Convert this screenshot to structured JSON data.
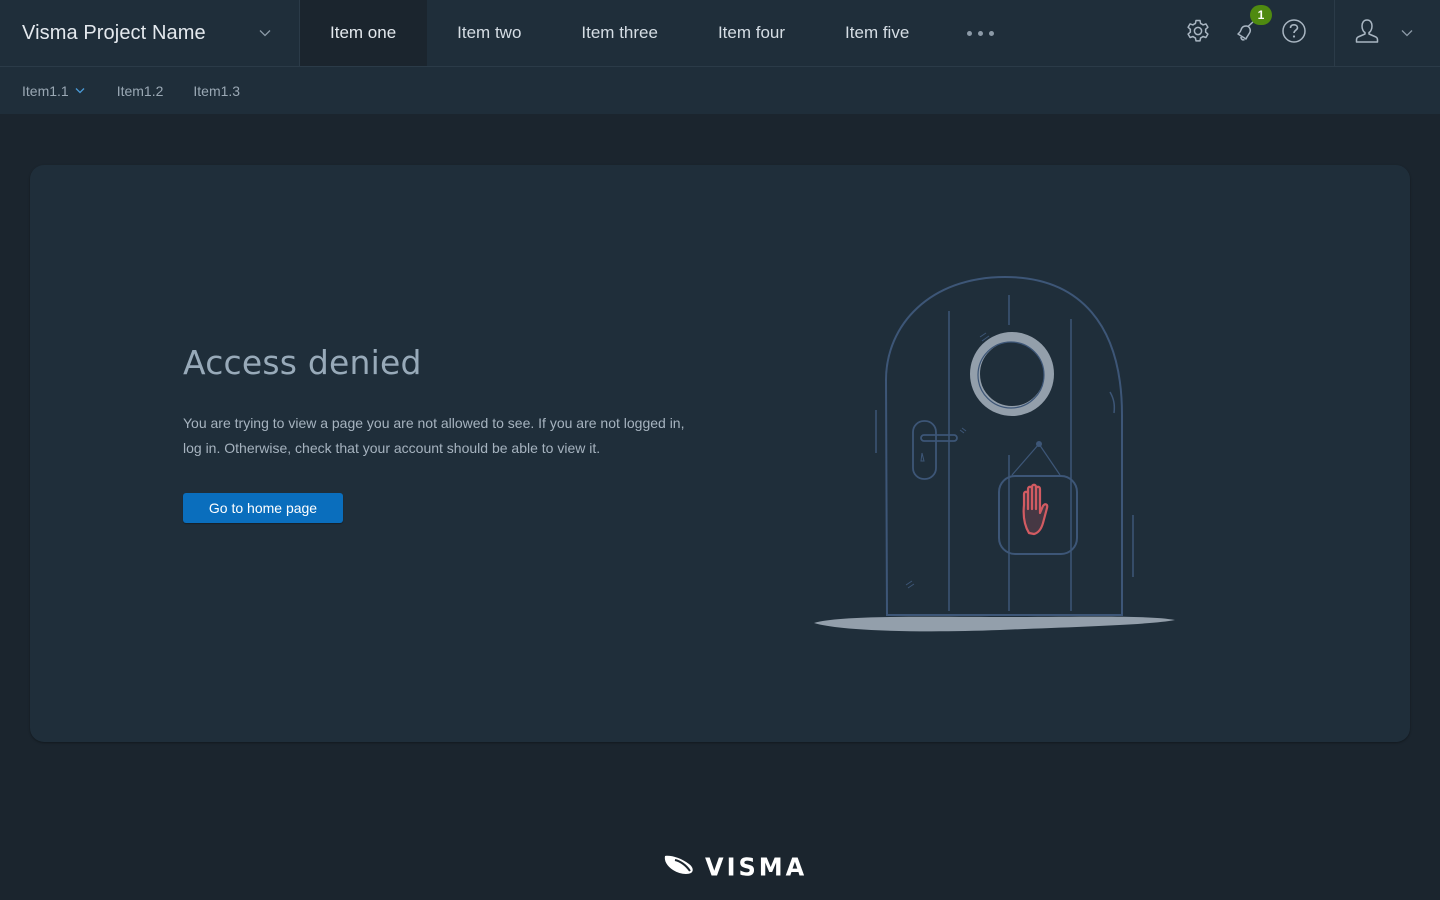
{
  "header": {
    "project_name": "Visma Project Name",
    "nav_items": [
      {
        "label": "Item one",
        "active": true
      },
      {
        "label": "Item two",
        "active": false
      },
      {
        "label": "Item three",
        "active": false
      },
      {
        "label": "Item four",
        "active": false
      },
      {
        "label": "Item five",
        "active": false
      }
    ],
    "more_icon": "more-horizontal-icon",
    "icons": {
      "settings": "gear-icon",
      "notifications": "bell-icon",
      "help": "help-icon",
      "user": "user-icon"
    },
    "notification_count": "1",
    "badge_color": "#4f8a10"
  },
  "subnav": {
    "items": [
      {
        "label": "Item1.1",
        "has_dropdown": true
      },
      {
        "label": "Item1.2",
        "has_dropdown": false
      },
      {
        "label": "Item1.3",
        "has_dropdown": false
      }
    ]
  },
  "main": {
    "title": "Access denied",
    "description": "You are trying to view a page you are not allowed to see. If you are not logged in, log in. Otherwise, check that your account should be able to view it.",
    "home_button_label": "Go to home page",
    "accent_color": "#0a6ebd",
    "illustration": "locked-door-stop-hand-illustration"
  },
  "footer": {
    "logo_text": "VISMA"
  }
}
